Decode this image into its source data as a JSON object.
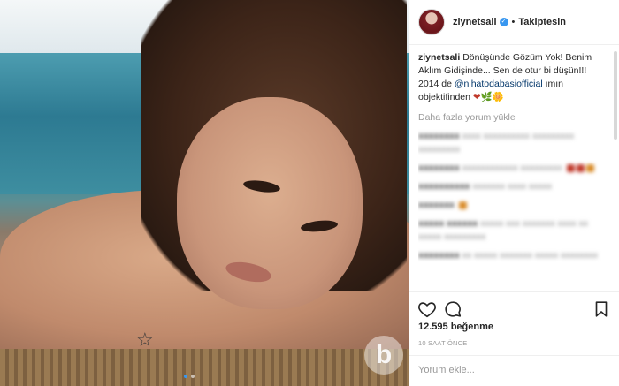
{
  "post": {
    "username": "ziynetsali",
    "follow_label": "Takiptesin",
    "separator": "•",
    "caption_text": "Dönüşünde Gözüm Yok! Benim Aklım Gidişinde... Sen de otur bi düşün!!! 2014 de ",
    "caption_mention": "@nihatodabasiofficial",
    "caption_suffix": " ımın objektifinden ",
    "caption_emojis": "❤🌿🌼",
    "load_more": "Daha fazla yorum yükle",
    "likes": "12.595 beğenme",
    "time": "10 SAAT ÖNCE",
    "comment_placeholder": "Yorum ekle...",
    "watermark": "b"
  },
  "comments": [
    {
      "user": "xxxxxxxx",
      "text": "xxxx xxxxxxxxxx xxxxxxxxx xxxxxxxxx"
    },
    {
      "user": "xxxxxxxx",
      "text": "xxxxxxxxxxxx xxxxxxxxx"
    },
    {
      "user": "xxxxxxxxxx",
      "text": "xxxxxxx xxxx xxxxx"
    },
    {
      "user": "xxxxxxx",
      "text": ""
    },
    {
      "user": "xxxxx xxxxxx",
      "text": "xxxxx xxx xxxxxxx xxxx xx xxxxx xxxxxxxxx"
    },
    {
      "user": "xxxxxxxx",
      "text": "xx xxxxx xxxxxxx xxxxx xxxxxxxx"
    }
  ],
  "icons": {
    "verified": "verified-badge-icon",
    "heart": "heart-icon",
    "comment": "comment-icon",
    "bookmark": "bookmark-icon"
  }
}
